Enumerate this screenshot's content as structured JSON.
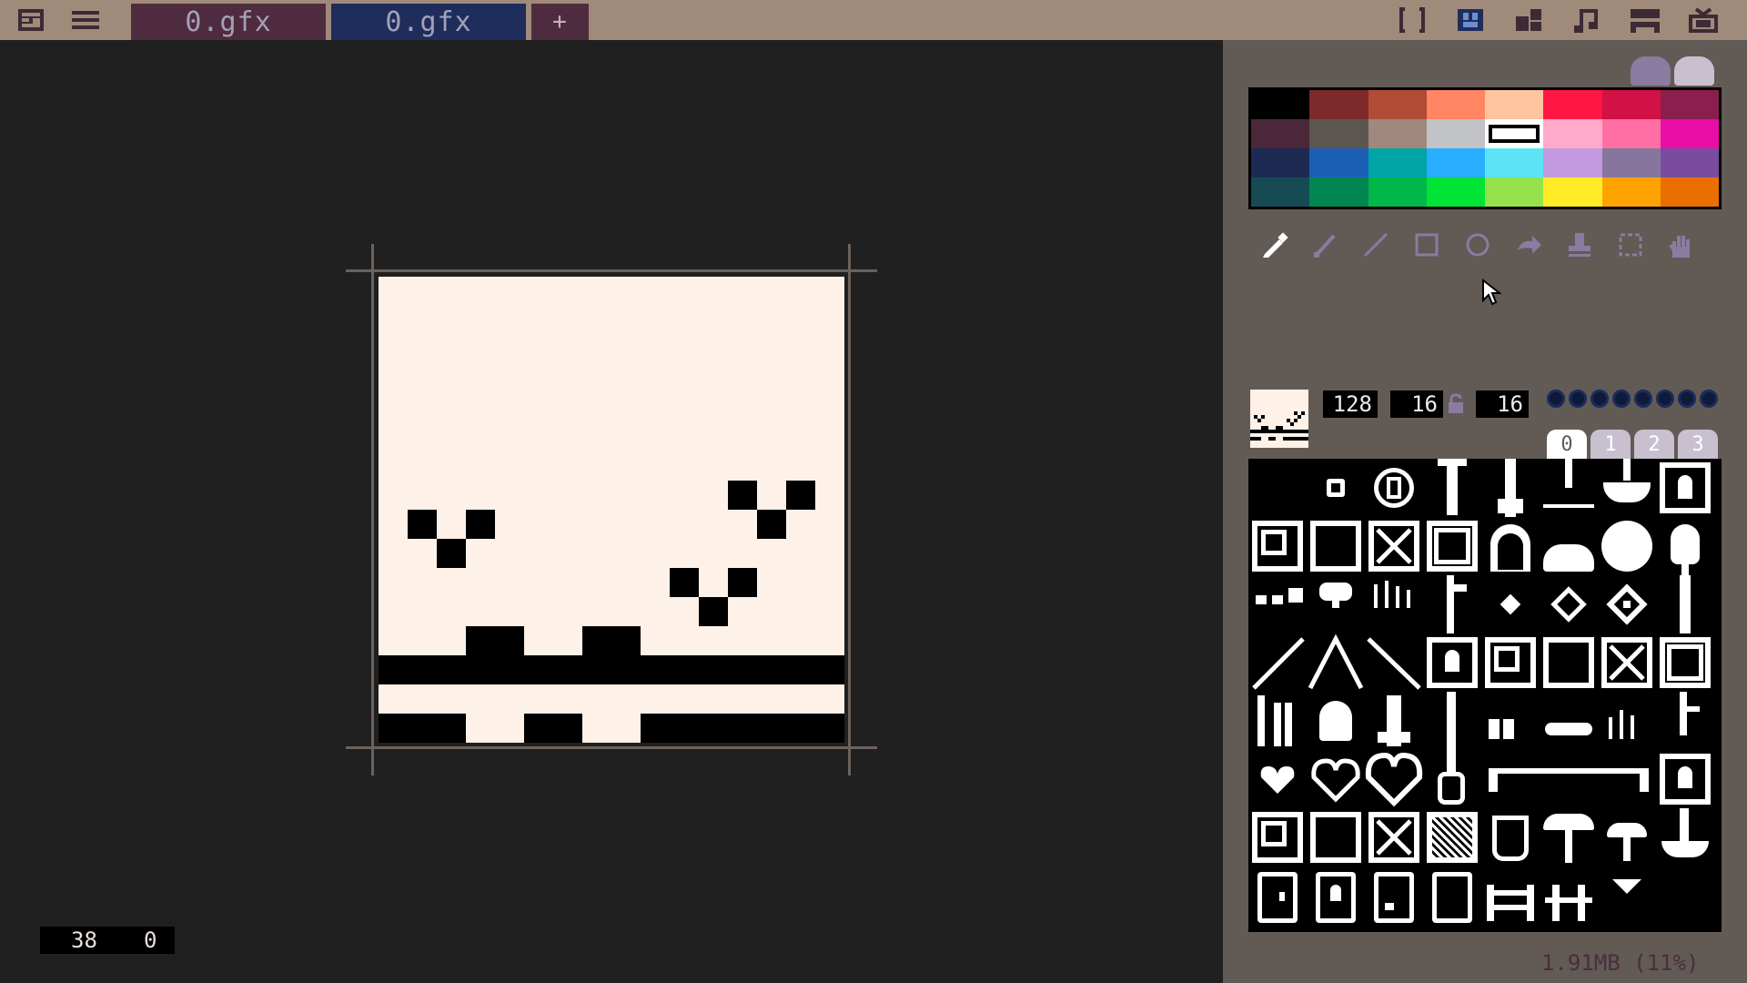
{
  "topbar": {
    "tabs": [
      {
        "label": "0.gfx"
      },
      {
        "label": "0.gfx"
      }
    ],
    "add_tab_label": "+",
    "right_icons": [
      "code-editor-icon",
      "sprite-editor-icon",
      "map-editor-icon",
      "sfx-editor-icon",
      "music-editor-icon",
      "export-icon"
    ]
  },
  "canvas": {
    "coords": {
      "x": "38",
      "y": "0"
    }
  },
  "palette": {
    "colors": [
      "#000000",
      "#7f2a2a",
      "#b04c36",
      "#ff8563",
      "#ffc4a0",
      "#ff1744",
      "#d21147",
      "#8a1f4e",
      "#4a2839",
      "#5c5650",
      "#a1887f",
      "#c2c3c7",
      "#ffffff",
      "#ffaacb",
      "#ff6fa3",
      "#e90ea6",
      "#1d2b53",
      "#1b60b5",
      "#00a5a5",
      "#29adff",
      "#5ae4f5",
      "#c39ae0",
      "#86769e",
      "#7a4c9e",
      "#164b54",
      "#008751",
      "#00b84a",
      "#00e436",
      "#95e24c",
      "#ffec27",
      "#ffa300",
      "#ea6e00"
    ],
    "selected_index": 12
  },
  "tools": [
    "pencil-icon",
    "brush-icon",
    "line-icon",
    "rect-icon",
    "circle-icon",
    "fill-icon",
    "stamp-icon",
    "select-icon",
    "pan-icon"
  ],
  "sprite_info": {
    "zoom": "128",
    "width": "16",
    "height": "16"
  },
  "sheet_tabs": [
    "0",
    "1",
    "2",
    "3"
  ],
  "active_sheet": 0,
  "status": {
    "memory": "1.91MB (11%)"
  }
}
